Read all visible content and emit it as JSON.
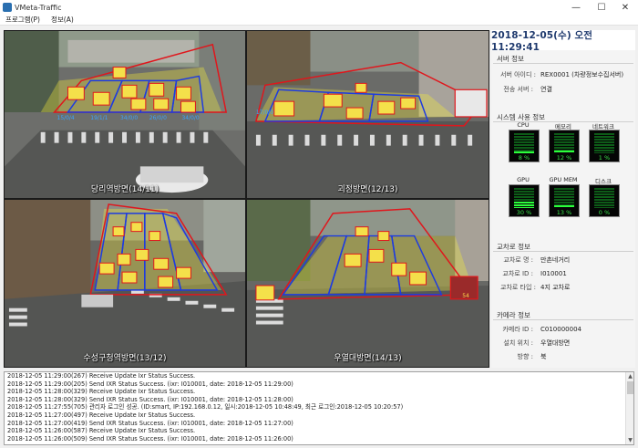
{
  "window": {
    "title": "VMeta-Traffic",
    "minimize": "—",
    "maximize": "☐",
    "close": "✕"
  },
  "menu": {
    "items": [
      "프로그램(P)",
      "정보(A)"
    ]
  },
  "cameras": [
    {
      "label": "당리역방면(14/11)",
      "lanes": [
        "15/0/4",
        "19/1/1",
        "34/0/0",
        "26/0/0",
        "34/0/0"
      ]
    },
    {
      "label": "괴정방면(12/13)",
      "lanes": [
        "17/0/0"
      ]
    },
    {
      "label": "수성구청역방면(13/12)",
      "lanes": []
    },
    {
      "label": "우열대방면(14/13)",
      "lanes": [
        "54"
      ]
    }
  ],
  "clock": "2018-12-05(수) 오전 11:29:41",
  "server_info": {
    "title": "서버 정보",
    "server_id_key": "서버 아이디 :",
    "server_id_val": "REX0001 (차량정보수집서버)",
    "transfer_key": "전송 서버 :",
    "transfer_val": "연결"
  },
  "system_usage": {
    "title": "시스템 사용 정보",
    "meters": [
      {
        "label": "CPU",
        "value": "8 %",
        "level": 0.08
      },
      {
        "label": "메모리",
        "value": "12 %",
        "level": 0.12
      },
      {
        "label": "네트워크",
        "value": "1 %",
        "level": 0.01
      },
      {
        "label": "GPU",
        "value": "30 %",
        "level": 0.3
      },
      {
        "label": "GPU MEM",
        "value": "13 %",
        "level": 0.13
      },
      {
        "label": "디스크",
        "value": "0 %",
        "level": 0.0
      }
    ]
  },
  "intersection_info": {
    "title": "교차로 정보",
    "name_key": "교차로 명 :",
    "name_val": "만촌네거리",
    "id_key": "교차로 ID :",
    "id_val": "I010001",
    "type_key": "교차로 타입 :",
    "type_val": "4지 교차로"
  },
  "camera_info": {
    "title": "카메라 정보",
    "id_key": "카메라 ID :",
    "id_val": "C010000004",
    "location_key": "설치 위치 :",
    "location_val": "우열대방면",
    "direction_key": "방향 :",
    "direction_val": "북"
  },
  "colors": {
    "clock_text": "#1f3a6e",
    "meter_on": "#2cff3c",
    "box_red": "#e0161c",
    "box_blue": "#1d3be0"
  },
  "log": [
    "2018-12-05 11:29:00(267) Receive Update Ixr Status Success.",
    "2018-12-05 11:29:00(205) Send IXR Status Success. (ixr: I010001, date: 2018-12-05 11:29:00)",
    "2018-12-05 11:28:00(329) Receive Update Ixr Status Success.",
    "2018-12-05 11:28:00(329) Send IXR Status Success. (ixr: I010001, date: 2018-12-05 11:28:00)",
    "2018-12-05 11:27:55(705) 관리자 로그인 성공. (ID:smart, IP:192.168.0.12, 일시:2018-12-05 10:48:49, 최근 로그인:2018-12-05 10:20:57)",
    "2018-12-05 11:27:00(497) Receive Update Ixr Status Success.",
    "2018-12-05 11:27:00(419) Send IXR Status Success. (ixr: I010001, date: 2018-12-05 11:27:00)",
    "2018-12-05 11:26:00(587) Receive Update Ixr Status Success.",
    "2018-12-05 11:26:00(509) Send IXR Status Success. (ixr: I010001, date: 2018-12-05 11:26:00)"
  ]
}
